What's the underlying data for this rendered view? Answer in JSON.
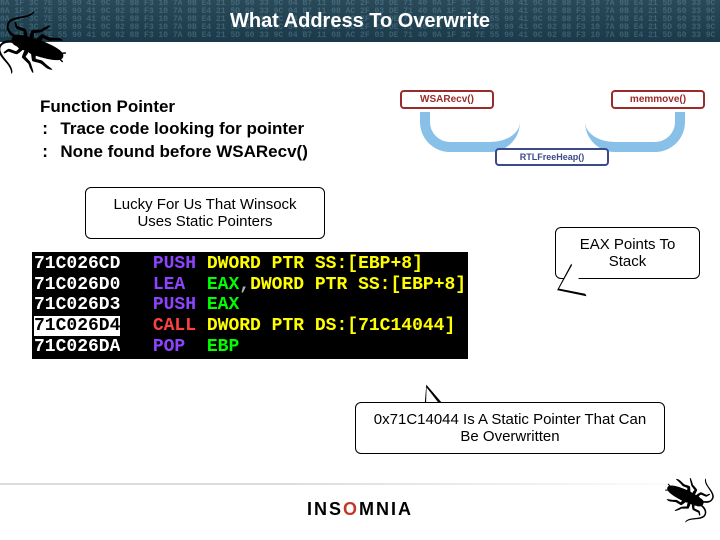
{
  "title": "What Address To Overwrite",
  "fp": {
    "heading": "Function Pointer",
    "item1": "Trace code looking for pointer",
    "item2": "None found before WSARecv()"
  },
  "note_lucky": "Lucky For Us That Winsock Uses Static Pointers",
  "note_eax": "EAX Points To Stack",
  "note_static": "0x71C14044 Is A Static Pointer That Can Be Overwritten",
  "flow": {
    "left": "WSARecv()",
    "right": "memmove()",
    "bottom": "RTLFreeHeap()"
  },
  "disasm": [
    {
      "addr": "71C026CD",
      "sel": false,
      "mn": "PUSH",
      "ops": [
        {
          "t": "mem",
          "v": "DWORD PTR SS:[EBP+8]"
        }
      ]
    },
    {
      "addr": "71C026D0",
      "sel": false,
      "mn": "LEA",
      "ops": [
        {
          "t": "reg",
          "v": "EAX"
        },
        {
          "t": "comma",
          "v": ","
        },
        {
          "t": "mem",
          "v": "DWORD PTR SS:[EBP+8]"
        }
      ]
    },
    {
      "addr": "71C026D3",
      "sel": false,
      "mn": "PUSH",
      "ops": [
        {
          "t": "reg",
          "v": "EAX"
        }
      ]
    },
    {
      "addr": "71C026D4",
      "sel": true,
      "mn": "CALL",
      "ops": [
        {
          "t": "mem",
          "v": "DWORD PTR DS:[71C14044]"
        }
      ]
    },
    {
      "addr": "71C026DA",
      "sel": false,
      "mn": "POP",
      "ops": [
        {
          "t": "reg",
          "v": "EBP"
        }
      ]
    }
  ],
  "footer": {
    "brand_pre": "INS",
    "brand_dot": "O",
    "brand_post": "MNIA"
  }
}
